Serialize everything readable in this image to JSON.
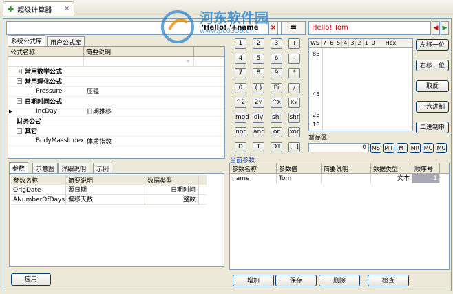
{
  "tab": {
    "title": "超级计算器",
    "close": "✕"
  },
  "formula": {
    "expression": "'Hello! '+name",
    "clear": "×",
    "equals": "=",
    "result": "Hello! Tom"
  },
  "lib_tabs": [
    "系统公式库",
    "用户公式库"
  ],
  "lib_grid": {
    "headers": [
      "公式名称",
      "简要说明"
    ],
    "rows": [
      {
        "name": "常用数学公式",
        "desc": "",
        "level": 0,
        "expander": "+"
      },
      {
        "name": "常用理化公式",
        "desc": "",
        "level": 0,
        "expander": "−"
      },
      {
        "name": "Pressure",
        "desc": "压强",
        "level": 1
      },
      {
        "name": "日期时间公式",
        "desc": "",
        "level": 0,
        "expander": "−"
      },
      {
        "name": "IncDay",
        "desc": "日期推移",
        "level": 1
      },
      {
        "name": "财务公式",
        "desc": "",
        "level": 0
      },
      {
        "name": "其它",
        "desc": "",
        "level": 0,
        "expander": "−"
      },
      {
        "name": "BodyMassIndex",
        "desc": "体质指数",
        "level": 1
      }
    ]
  },
  "param_tabs": [
    "参数",
    "示意图",
    "详细说明",
    "示例"
  ],
  "param_grid": {
    "headers": [
      "参数名称",
      "简要说明",
      "数据类型"
    ],
    "rows": [
      {
        "name": "OrigDate",
        "desc": "源日期",
        "type": "日期时间"
      },
      {
        "name": "ANumberOfDays",
        "desc": "偏移天数",
        "type": "整数"
      }
    ]
  },
  "apply_label": "应用",
  "keypad": [
    [
      "1",
      "2",
      "3",
      "+"
    ],
    [
      "4",
      "5",
      "6",
      "-"
    ],
    [
      "7",
      "8",
      "9",
      "*"
    ],
    [
      "0",
      "( )",
      "Pi",
      "/"
    ],
    [
      "^2",
      "2√",
      "^x",
      "x√"
    ],
    [
      "mod",
      "div",
      "shl",
      "shr"
    ],
    [
      "not",
      "and",
      "or",
      "xor"
    ],
    [
      "D",
      "T",
      "DT",
      "[ .]"
    ]
  ],
  "register": {
    "header": [
      "WS",
      "7",
      "6",
      "5",
      "4",
      "3",
      "2",
      "1",
      "0",
      "Hex"
    ],
    "labels": [
      "8B",
      "4B",
      "2B",
      "1B"
    ]
  },
  "side_buttons": [
    "左移一位",
    "右移一位",
    "取反",
    "十六进制",
    "二进制串"
  ],
  "memory": {
    "label": "暂存区",
    "value": "0",
    "buttons": [
      "MS",
      "M+",
      "M-",
      "MR",
      "MC",
      "MU"
    ]
  },
  "current_params": {
    "label": "当前参数",
    "headers": [
      "参数名称",
      "参数值",
      "简要说明",
      "数据类型",
      "顺序号"
    ],
    "rows": [
      {
        "name": "name",
        "value": "Tom",
        "desc": "",
        "type": "文本",
        "order": "1"
      }
    ]
  },
  "bottom_buttons": [
    "增加",
    "保存",
    "删除",
    "检查"
  ],
  "watermark": {
    "text": "河东软件园",
    "url": "www.pc0359.cn"
  },
  "colors": {
    "accent": "#2f86cc",
    "result": "#cc0000"
  }
}
